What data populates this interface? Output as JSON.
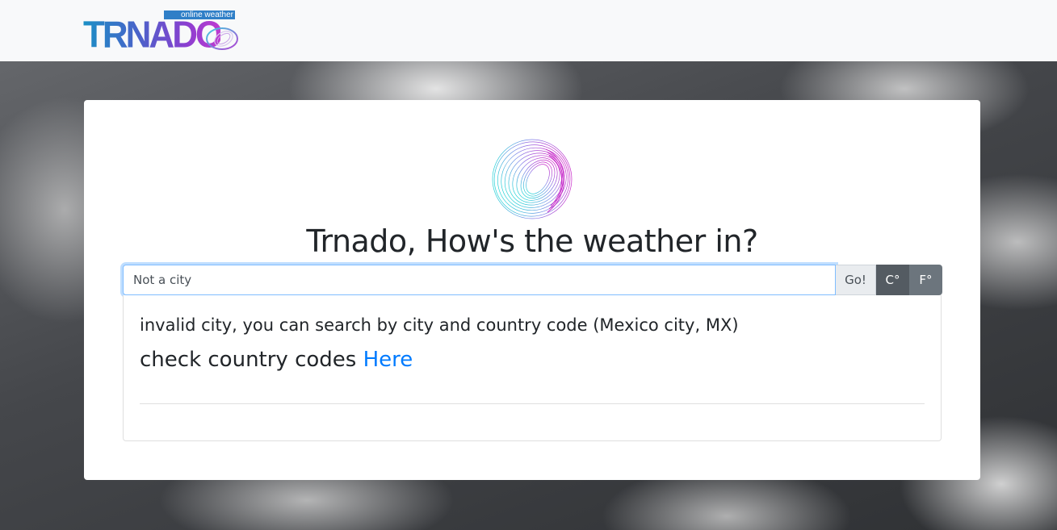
{
  "brand": {
    "tagline": "online weather",
    "wordmark": "TRNADO",
    "logo_icon": "ring-swirl-logo"
  },
  "main": {
    "hero_icon": "ring-swirl-icon",
    "headline": "Trnado, How's the weather in?",
    "search": {
      "value": "Not a city",
      "placeholder": ""
    },
    "go_label": "Go!",
    "unit_celsius_label": "C°",
    "unit_fahrenheit_label": "F°",
    "selected_unit": "C°"
  },
  "result": {
    "error_message": "invalid city, you can search by city and country code (Mexico city, MX)",
    "codes_prefix": "check country codes ",
    "codes_link_label": "Here"
  },
  "colors": {
    "navbar_bg": "#f8f9fa",
    "focus_border": "#80bdff",
    "link": "#007bff",
    "unit_active": "#545b62",
    "unit_inactive": "#6c757d",
    "logo_gradient_start": "#1a8fc5",
    "logo_gradient_end": "#c03ad0"
  }
}
